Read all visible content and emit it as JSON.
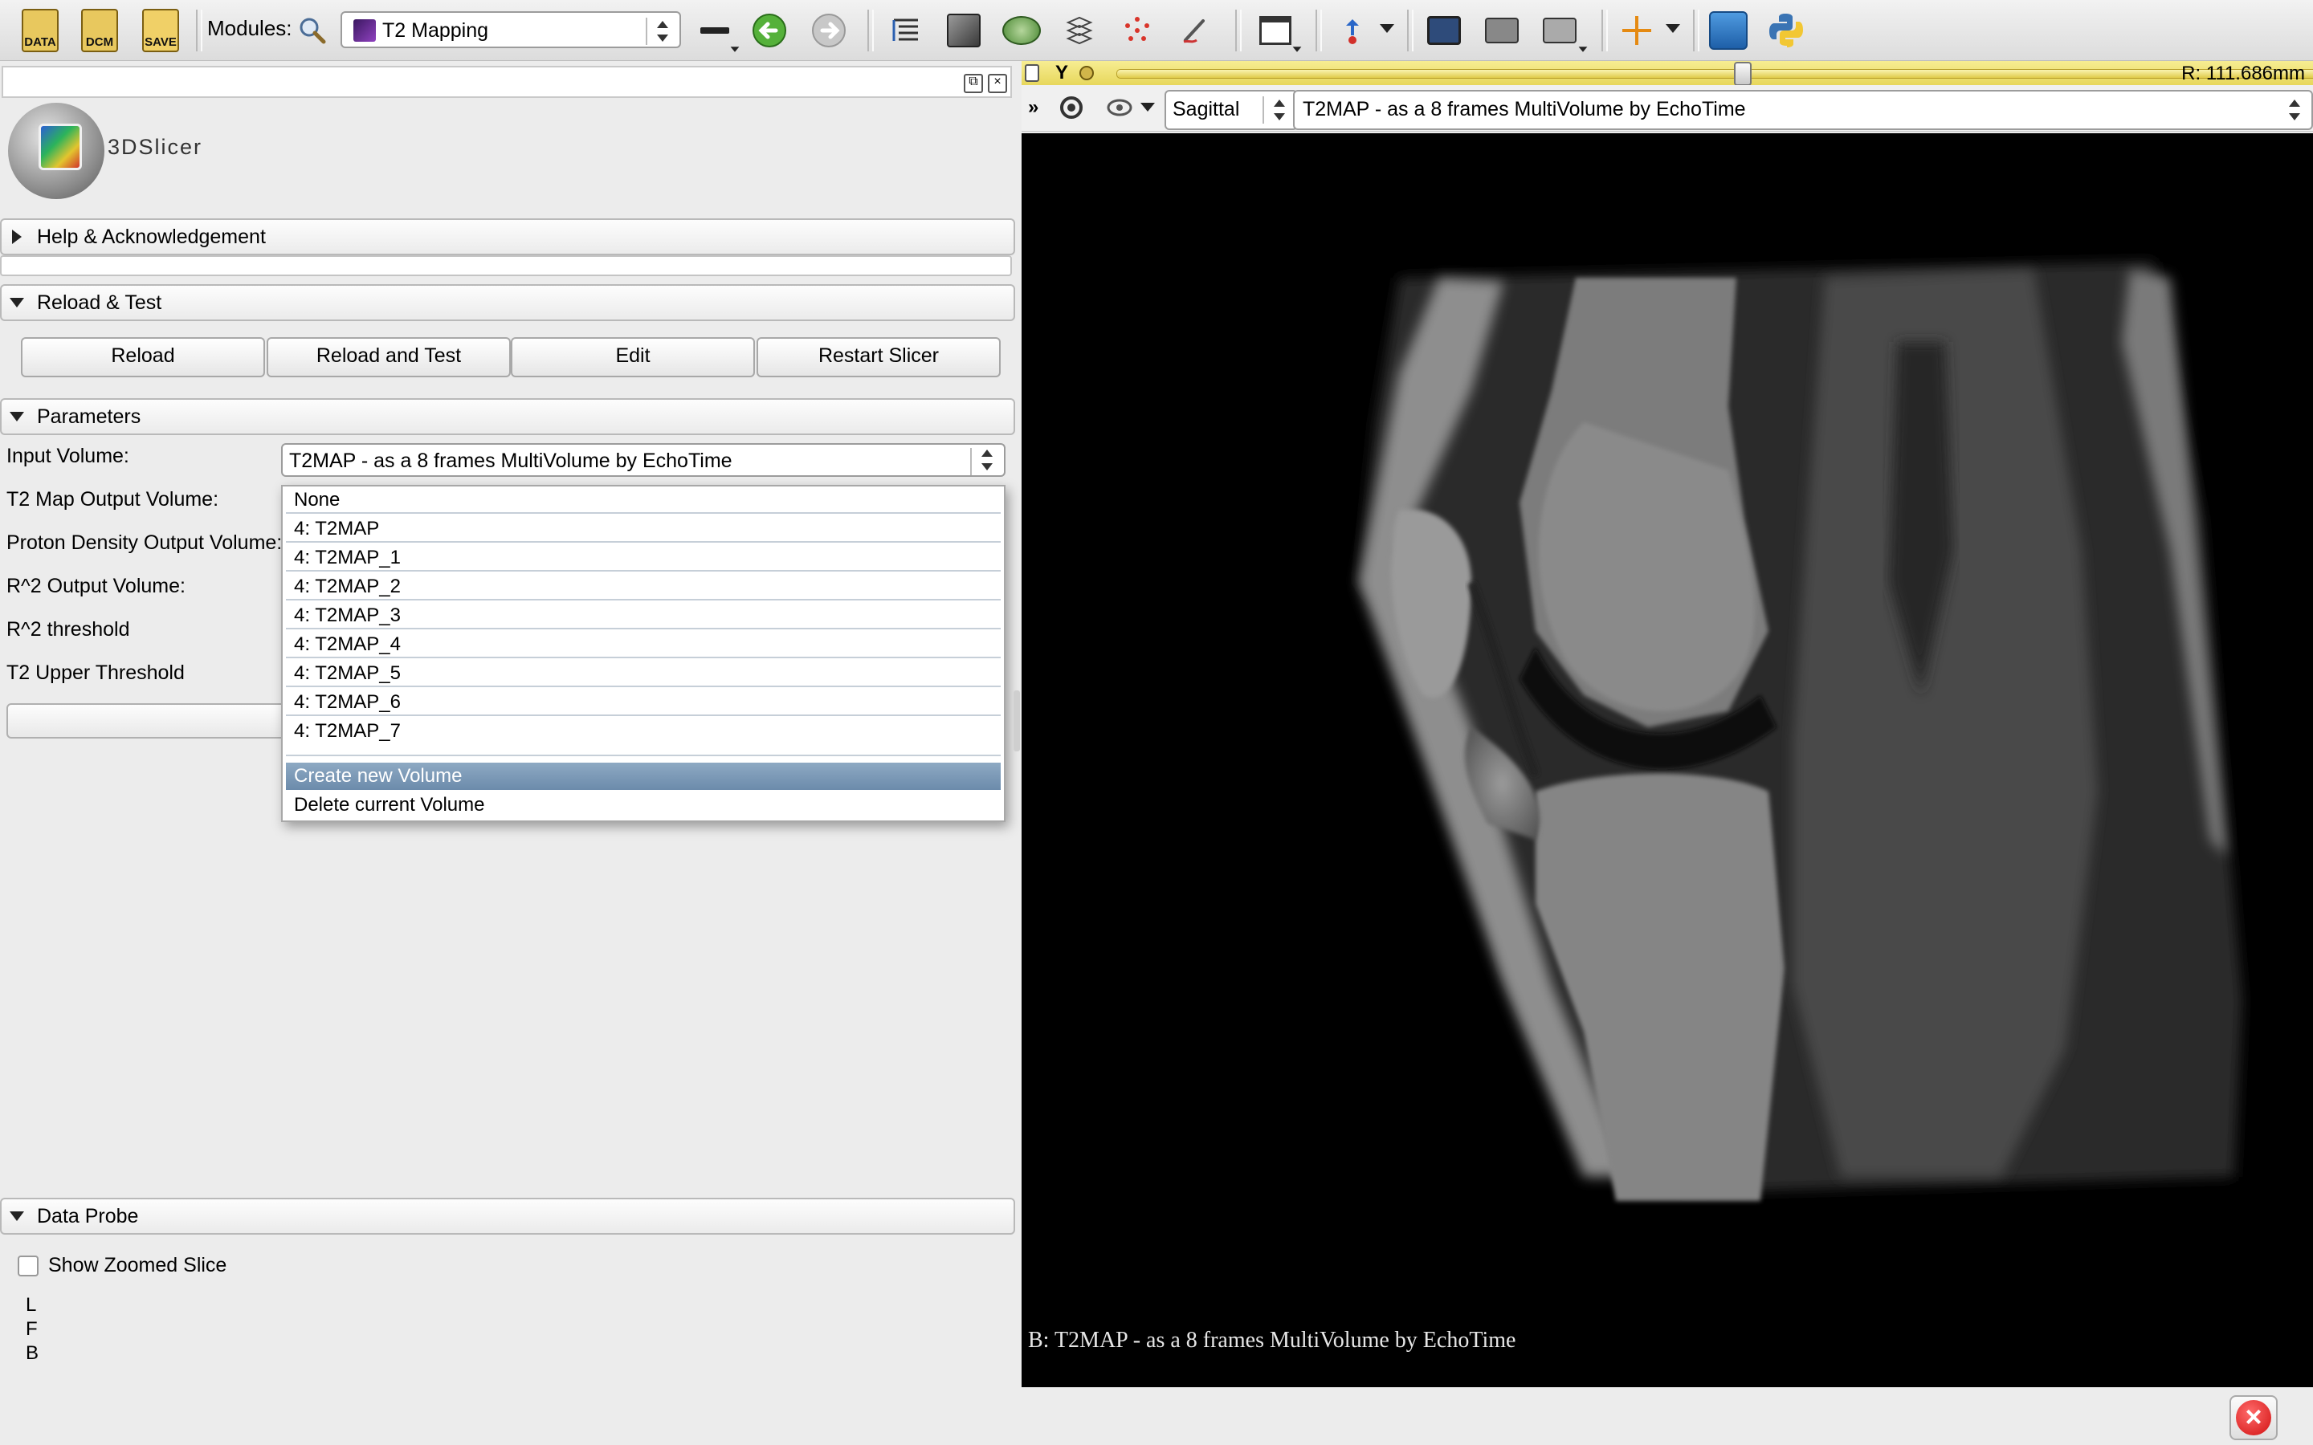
{
  "toolbar": {
    "data_label": "DATA",
    "dcm_label": "DCM",
    "save_label": "SAVE",
    "modules_label": "Modules:",
    "module_selected": "T2 Mapping"
  },
  "logo": {
    "text": "3DSlicer"
  },
  "sections": {
    "help": "Help & Acknowledgement",
    "reload_test": "Reload & Test",
    "parameters": "Parameters",
    "data_probe": "Data Probe"
  },
  "buttons": {
    "reload": "Reload",
    "reload_and_test": "Reload and Test",
    "edit": "Edit",
    "restart": "Restart Slicer"
  },
  "parameters": {
    "input_volume_label": "Input Volume:",
    "input_volume_value": "T2MAP - as a 8 frames MultiVolume by EchoTime",
    "t2_map_output_label": "T2 Map Output Volume:",
    "proton_density_label": "Proton Density Output Volume:",
    "r2_output_label": "R^2 Output Volume:",
    "r2_threshold_label": "R^2 threshold",
    "t2_upper_threshold_label": "T2 Upper Threshold"
  },
  "dropdown": {
    "items": [
      "None",
      "4: T2MAP",
      "4: T2MAP_1",
      "4: T2MAP_2",
      "4: T2MAP_3",
      "4: T2MAP_4",
      "4: T2MAP_5",
      "4: T2MAP_6",
      "4: T2MAP_7"
    ],
    "create": "Create new Volume",
    "delete": "Delete current Volume"
  },
  "data_probe": {
    "show_zoomed_label": "Show Zoomed Slice",
    "l": "L",
    "f": "F",
    "b": "B"
  },
  "slice_view": {
    "axis": "Y",
    "position": "R: 111.686mm",
    "orientation": "Sagittal",
    "background_volume": "T2MAP - as a 8 frames MultiVolume by EchoTime",
    "caption": "B: T2MAP - as a 8 frames MultiVolume by EchoTime",
    "slider_fraction": 0.49
  },
  "colors": {
    "slice_bar": "#e7d75c",
    "selected_item": "#7b97b4"
  },
  "icons": [
    "load-data-icon",
    "dicom-icon",
    "save-icon",
    "search-icon",
    "back-icon",
    "forward-icon",
    "python-icon",
    "error-icon"
  ]
}
